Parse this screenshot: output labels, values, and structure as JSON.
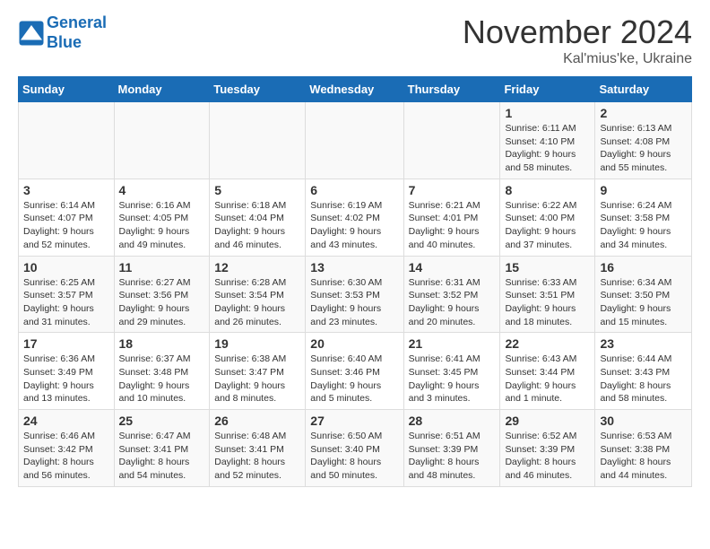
{
  "logo": {
    "line1": "General",
    "line2": "Blue"
  },
  "title": "November 2024",
  "location": "Kal'mius'ke, Ukraine",
  "weekdays": [
    "Sunday",
    "Monday",
    "Tuesday",
    "Wednesday",
    "Thursday",
    "Friday",
    "Saturday"
  ],
  "weeks": [
    [
      {
        "day": "",
        "info": ""
      },
      {
        "day": "",
        "info": ""
      },
      {
        "day": "",
        "info": ""
      },
      {
        "day": "",
        "info": ""
      },
      {
        "day": "",
        "info": ""
      },
      {
        "day": "1",
        "info": "Sunrise: 6:11 AM\nSunset: 4:10 PM\nDaylight: 9 hours and 58 minutes."
      },
      {
        "day": "2",
        "info": "Sunrise: 6:13 AM\nSunset: 4:08 PM\nDaylight: 9 hours and 55 minutes."
      }
    ],
    [
      {
        "day": "3",
        "info": "Sunrise: 6:14 AM\nSunset: 4:07 PM\nDaylight: 9 hours and 52 minutes."
      },
      {
        "day": "4",
        "info": "Sunrise: 6:16 AM\nSunset: 4:05 PM\nDaylight: 9 hours and 49 minutes."
      },
      {
        "day": "5",
        "info": "Sunrise: 6:18 AM\nSunset: 4:04 PM\nDaylight: 9 hours and 46 minutes."
      },
      {
        "day": "6",
        "info": "Sunrise: 6:19 AM\nSunset: 4:02 PM\nDaylight: 9 hours and 43 minutes."
      },
      {
        "day": "7",
        "info": "Sunrise: 6:21 AM\nSunset: 4:01 PM\nDaylight: 9 hours and 40 minutes."
      },
      {
        "day": "8",
        "info": "Sunrise: 6:22 AM\nSunset: 4:00 PM\nDaylight: 9 hours and 37 minutes."
      },
      {
        "day": "9",
        "info": "Sunrise: 6:24 AM\nSunset: 3:58 PM\nDaylight: 9 hours and 34 minutes."
      }
    ],
    [
      {
        "day": "10",
        "info": "Sunrise: 6:25 AM\nSunset: 3:57 PM\nDaylight: 9 hours and 31 minutes."
      },
      {
        "day": "11",
        "info": "Sunrise: 6:27 AM\nSunset: 3:56 PM\nDaylight: 9 hours and 29 minutes."
      },
      {
        "day": "12",
        "info": "Sunrise: 6:28 AM\nSunset: 3:54 PM\nDaylight: 9 hours and 26 minutes."
      },
      {
        "day": "13",
        "info": "Sunrise: 6:30 AM\nSunset: 3:53 PM\nDaylight: 9 hours and 23 minutes."
      },
      {
        "day": "14",
        "info": "Sunrise: 6:31 AM\nSunset: 3:52 PM\nDaylight: 9 hours and 20 minutes."
      },
      {
        "day": "15",
        "info": "Sunrise: 6:33 AM\nSunset: 3:51 PM\nDaylight: 9 hours and 18 minutes."
      },
      {
        "day": "16",
        "info": "Sunrise: 6:34 AM\nSunset: 3:50 PM\nDaylight: 9 hours and 15 minutes."
      }
    ],
    [
      {
        "day": "17",
        "info": "Sunrise: 6:36 AM\nSunset: 3:49 PM\nDaylight: 9 hours and 13 minutes."
      },
      {
        "day": "18",
        "info": "Sunrise: 6:37 AM\nSunset: 3:48 PM\nDaylight: 9 hours and 10 minutes."
      },
      {
        "day": "19",
        "info": "Sunrise: 6:38 AM\nSunset: 3:47 PM\nDaylight: 9 hours and 8 minutes."
      },
      {
        "day": "20",
        "info": "Sunrise: 6:40 AM\nSunset: 3:46 PM\nDaylight: 9 hours and 5 minutes."
      },
      {
        "day": "21",
        "info": "Sunrise: 6:41 AM\nSunset: 3:45 PM\nDaylight: 9 hours and 3 minutes."
      },
      {
        "day": "22",
        "info": "Sunrise: 6:43 AM\nSunset: 3:44 PM\nDaylight: 9 hours and 1 minute."
      },
      {
        "day": "23",
        "info": "Sunrise: 6:44 AM\nSunset: 3:43 PM\nDaylight: 8 hours and 58 minutes."
      }
    ],
    [
      {
        "day": "24",
        "info": "Sunrise: 6:46 AM\nSunset: 3:42 PM\nDaylight: 8 hours and 56 minutes."
      },
      {
        "day": "25",
        "info": "Sunrise: 6:47 AM\nSunset: 3:41 PM\nDaylight: 8 hours and 54 minutes."
      },
      {
        "day": "26",
        "info": "Sunrise: 6:48 AM\nSunset: 3:41 PM\nDaylight: 8 hours and 52 minutes."
      },
      {
        "day": "27",
        "info": "Sunrise: 6:50 AM\nSunset: 3:40 PM\nDaylight: 8 hours and 50 minutes."
      },
      {
        "day": "28",
        "info": "Sunrise: 6:51 AM\nSunset: 3:39 PM\nDaylight: 8 hours and 48 minutes."
      },
      {
        "day": "29",
        "info": "Sunrise: 6:52 AM\nSunset: 3:39 PM\nDaylight: 8 hours and 46 minutes."
      },
      {
        "day": "30",
        "info": "Sunrise: 6:53 AM\nSunset: 3:38 PM\nDaylight: 8 hours and 44 minutes."
      }
    ]
  ]
}
